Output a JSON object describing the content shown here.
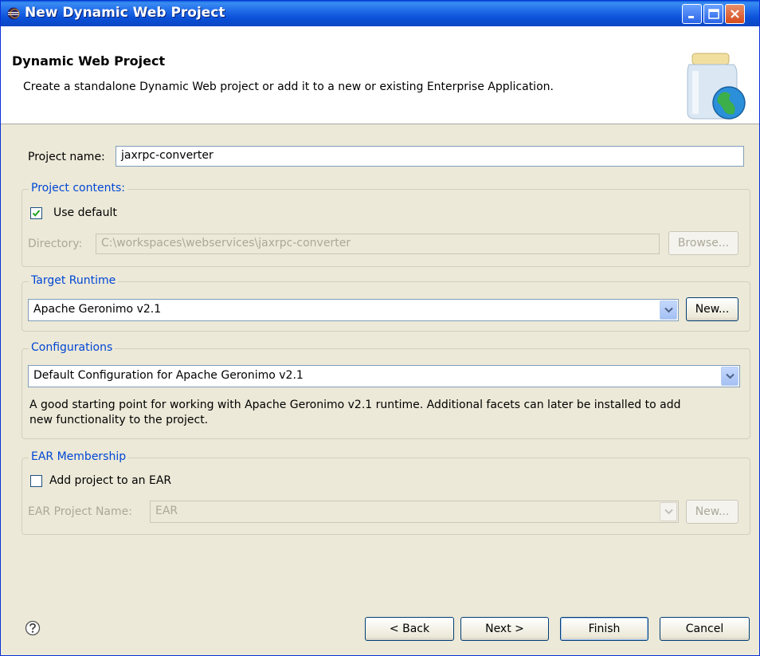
{
  "window": {
    "title": "New Dynamic Web Project"
  },
  "header": {
    "title": "Dynamic Web Project",
    "description": "Create a standalone Dynamic Web project or add it to a new or existing Enterprise Application."
  },
  "project_name": {
    "label": "Project name:",
    "value": "jaxrpc-converter"
  },
  "project_contents": {
    "title": "Project contents:",
    "use_default_label": "Use default",
    "use_default_checked": true,
    "directory_label": "Directory:",
    "directory_value": "C:\\workspaces\\webservices\\jaxrpc-converter",
    "browse_label": "Browse..."
  },
  "target_runtime": {
    "title": "Target Runtime",
    "selected": "Apache Geronimo v2.1",
    "new_label": "New..."
  },
  "configurations": {
    "title": "Configurations",
    "selected": "Default Configuration for Apache Geronimo v2.1",
    "description_line1": "A good starting point for working with Apache Geronimo v2.1 runtime. Additional facets can later be installed to add",
    "description_line2": "new functionality to the project."
  },
  "ear_membership": {
    "title": "EAR Membership",
    "add_label": "Add project to an EAR",
    "add_checked": false,
    "project_name_label": "EAR Project Name:",
    "project_name_value": "EAR",
    "new_label": "New..."
  },
  "footer": {
    "back_label": "< Back",
    "next_label": "Next >",
    "finish_label": "Finish",
    "cancel_label": "Cancel"
  },
  "icons": {
    "window": "eclipse-icon",
    "banner": "web-project-jar-globe-icon",
    "help": "help-question-icon"
  }
}
